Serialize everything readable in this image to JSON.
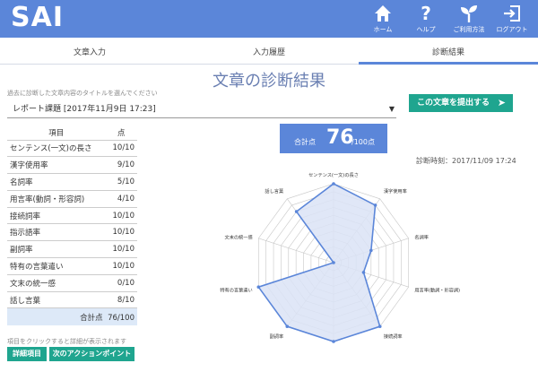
{
  "app": {
    "logo": "SAI"
  },
  "nav": [
    {
      "label": "ホーム",
      "icon": "home-icon"
    },
    {
      "label": "ヘルプ",
      "icon": "question-icon"
    },
    {
      "label": "ご利用方法",
      "icon": "sprout-icon"
    },
    {
      "label": "ログアウト",
      "icon": "logout-icon"
    }
  ],
  "tabs": [
    {
      "label": "文章入力",
      "active": false
    },
    {
      "label": "入力履歴",
      "active": false
    },
    {
      "label": "診断結果",
      "active": true
    }
  ],
  "page": {
    "title": "文章の診断結果",
    "select_hint": "過去に診断した文章内容のタイトルを選んでください",
    "selected_document": "レポート課題 [2017年11月9日 17:23]",
    "submit_label": "この文章を提出する",
    "score_label": "合計点",
    "score_value": "76",
    "score_suffix": "/100点",
    "diagnosis_time": "診断時刻：2017/11/09 17:24",
    "click_hint": "項目をクリックすると詳細が表示されます",
    "detail_button": "詳細項目",
    "next_action_button": "次のアクションポイント"
  },
  "table": {
    "headers": [
      "項目",
      "点"
    ],
    "rows": [
      [
        "センテンス(一文)の長さ",
        "10/10"
      ],
      [
        "漢字使用率",
        "9/10"
      ],
      [
        "名詞率",
        "5/10"
      ],
      [
        "用言率(動詞・形容詞)",
        "4/10"
      ],
      [
        "接続詞率",
        "10/10"
      ],
      [
        "指示語率",
        "10/10"
      ],
      [
        "副詞率",
        "10/10"
      ],
      [
        "特有の言葉遣い",
        "10/10"
      ],
      [
        "文末の統一感",
        "0/10"
      ],
      [
        "話し言葉",
        "8/10"
      ]
    ],
    "total_label": "合計点",
    "total_value": "76/100"
  },
  "chart_data": {
    "type": "radar",
    "axes": [
      "センテンス(一文)の長さ",
      "漢字使用率",
      "名詞率",
      "用言率(動詞・形容詞)",
      "接続詞率",
      "指示語率",
      "副詞率",
      "特有の言葉遣い",
      "文末の統一感",
      "話し言葉"
    ],
    "values": [
      10,
      9,
      5,
      4,
      10,
      10,
      10,
      10,
      0,
      8
    ],
    "max": 10,
    "rings": 10,
    "colors": {
      "fill": "#dbe3f6",
      "line": "#5b86d9",
      "grid": "#c8c8c8"
    }
  },
  "colors": {
    "accent": "#5b86d9",
    "button": "#1fa58f"
  }
}
